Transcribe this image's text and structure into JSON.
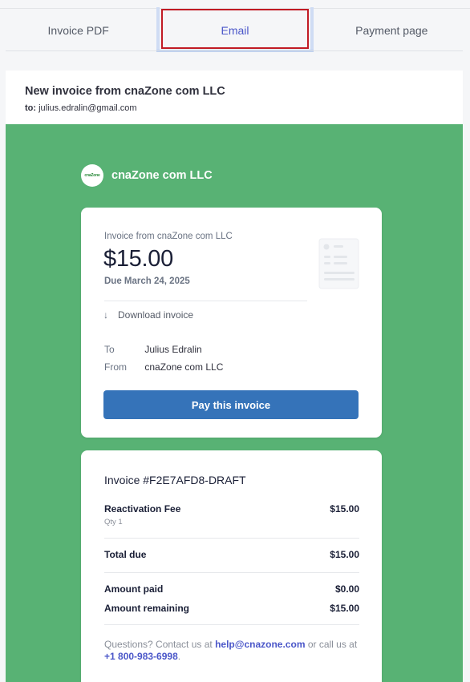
{
  "tabs": [
    {
      "label": "Invoice PDF",
      "active": false
    },
    {
      "label": "Email",
      "active": true
    },
    {
      "label": "Payment page",
      "active": false
    }
  ],
  "email": {
    "subject": "New invoice from cnaZone com LLC",
    "to_label": "to:",
    "to_address": "julius.edralin@gmail.com"
  },
  "brand": {
    "logo_text": "cnaZone",
    "name": "cnaZone com LLC"
  },
  "summary": {
    "from_line": "Invoice from cnaZone com LLC",
    "amount": "$15.00",
    "due": "Due March 24, 2025",
    "download_label": "Download invoice",
    "to_key": "To",
    "to_value": "Julius Edralin",
    "from_key": "From",
    "from_value": "cnaZone com LLC",
    "pay_button": "Pay this invoice"
  },
  "invoice": {
    "title": "Invoice #F2E7AFD8-DRAFT",
    "item_name": "Reactivation Fee",
    "item_qty": "Qty 1",
    "item_amount": "$15.00",
    "total_label": "Total due",
    "total_amount": "$15.00",
    "paid_label": "Amount paid",
    "paid_amount": "$0.00",
    "remaining_label": "Amount remaining",
    "remaining_amount": "$15.00",
    "footer_prefix": "Questions? Contact us at",
    "footer_email": "help@cnazone.com",
    "footer_middle": "or call us at",
    "footer_phone": "+1 800-983-6998",
    "footer_end": "."
  },
  "colors": {
    "green_bg": "#58b274",
    "pay_button": "#3573b9",
    "link": "#4b57c9",
    "tab_highlight": "#c11b24"
  }
}
